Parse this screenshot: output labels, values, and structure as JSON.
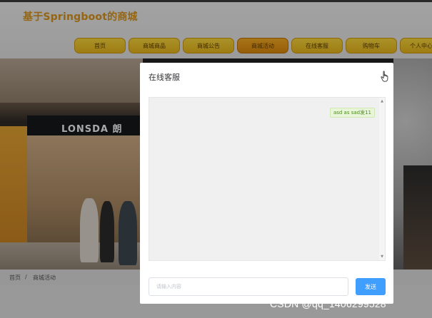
{
  "site": {
    "title": "基于Springboot的商城"
  },
  "nav": {
    "items": [
      {
        "label": "首页"
      },
      {
        "label": "商城商品"
      },
      {
        "label": "商城公告"
      },
      {
        "label": "商城活动",
        "active": true
      },
      {
        "label": "在线客服"
      },
      {
        "label": "购物车"
      },
      {
        "label": "个人中心"
      }
    ]
  },
  "banner": {
    "store_sign": "LONSDA 朗"
  },
  "breadcrumb": {
    "home": "首页",
    "separator": "/",
    "current": "商城活动"
  },
  "dialog": {
    "title": "在线客服",
    "messages": [
      {
        "text": "asd as sad发11",
        "side": "right"
      }
    ],
    "input": {
      "value": "",
      "placeholder": "请输入内容"
    },
    "send_label": "发送"
  },
  "watermark": "CSDN @qq_1406299528",
  "colors": {
    "accent": "#409eff",
    "nav_gold": "#e3b21b",
    "nav_active": "#d8860c",
    "title": "#d4911a"
  }
}
